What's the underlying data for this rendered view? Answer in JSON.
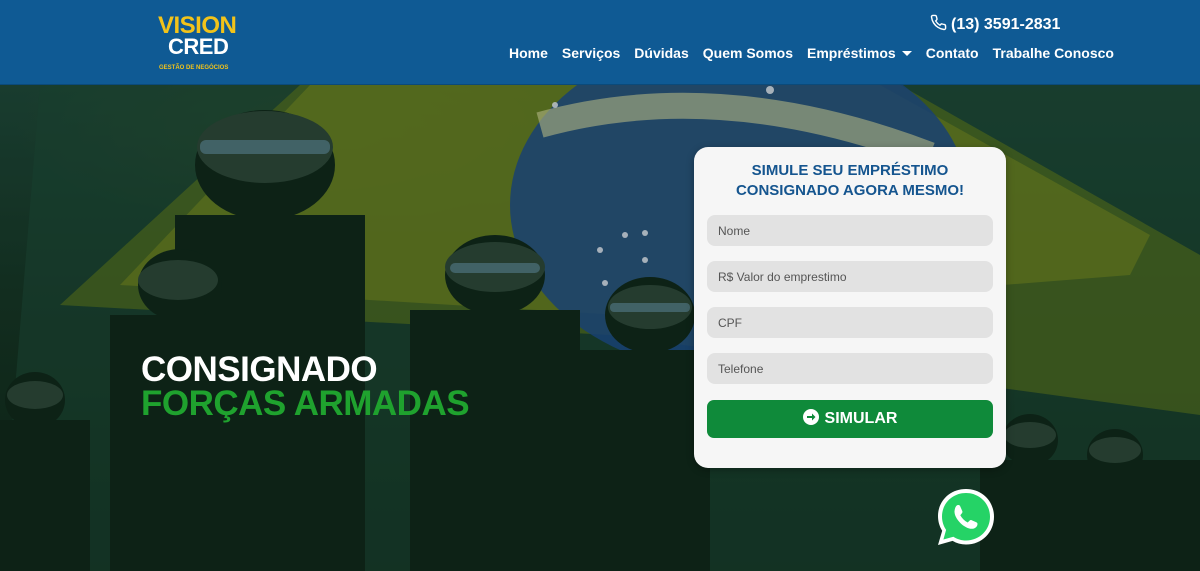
{
  "brand": {
    "line1": "VISION",
    "line2": "CRED",
    "tagline": "GESTÃO DE NEGÓCIOS",
    "yellow": "#f2c31a",
    "blue": "#0f5a94"
  },
  "header": {
    "phone": "(13) 3591-2831",
    "phone_icon": "phone-icon",
    "nav": [
      {
        "label": "Home"
      },
      {
        "label": "Serviços"
      },
      {
        "label": "Dúvidas"
      },
      {
        "label": "Quem Somos"
      },
      {
        "label": "Empréstimos"
      },
      {
        "label": "Contato"
      },
      {
        "label": "Trabalhe Conosco"
      }
    ]
  },
  "hero": {
    "line1": "CONSIGNADO",
    "line2": "FORÇAS ARMADAS",
    "accent": "#1fa22e"
  },
  "form": {
    "title1": "SIMULE SEU EMPRÉSTIMO",
    "title2": "CONSIGNADO AGORA MESMO!",
    "fields": {
      "name": {
        "placeholder": "Nome"
      },
      "value": {
        "placeholder": "R$ Valor do emprestimo"
      },
      "cpf": {
        "placeholder": "CPF"
      },
      "phone": {
        "placeholder": "Telefone"
      }
    },
    "submit_label": "SIMULAR",
    "submit_icon": "arrow-circle-right-icon",
    "button_color": "#0f8a3a"
  },
  "whatsapp": {
    "icon": "whatsapp-icon",
    "color": "#25d366"
  }
}
